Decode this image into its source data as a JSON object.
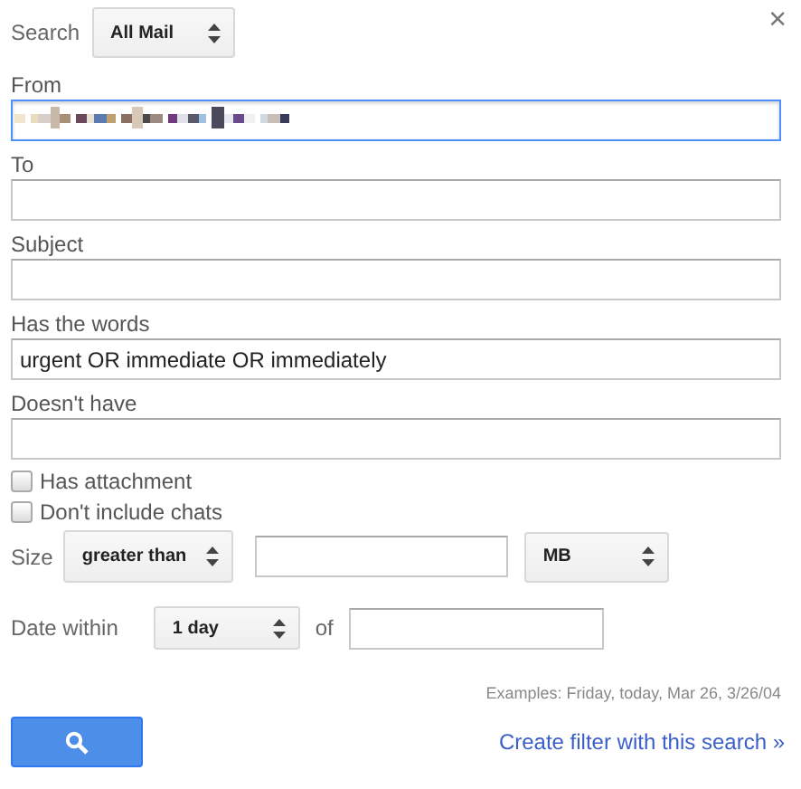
{
  "dialog": {
    "close": "×"
  },
  "search": {
    "label": "Search",
    "scope": "All Mail"
  },
  "fields": [
    {
      "label": "From",
      "focused": true,
      "redacted": true
    },
    {
      "label": "To",
      "focused": false,
      "redacted": false
    },
    {
      "label": "Subject",
      "focused": false,
      "redacted": false
    },
    {
      "label": "Has the words",
      "value": "urgent OR immediate OR immediately",
      "focused": false,
      "redacted": false
    },
    {
      "label": "Doesn't have",
      "focused": false,
      "redacted": false
    }
  ],
  "checkboxes": [
    {
      "label": "Has attachment",
      "checked": false
    },
    {
      "label": "Don't include chats",
      "checked": false
    }
  ],
  "size": {
    "label": "Size",
    "comparator": "greater than",
    "unit": "MB"
  },
  "date": {
    "label": "Date within",
    "range": "1 day",
    "of": "of"
  },
  "examples": "Examples: Friday, today, Mar 26, 3/26/04",
  "create_filter_link": "Create filter with this search »"
}
